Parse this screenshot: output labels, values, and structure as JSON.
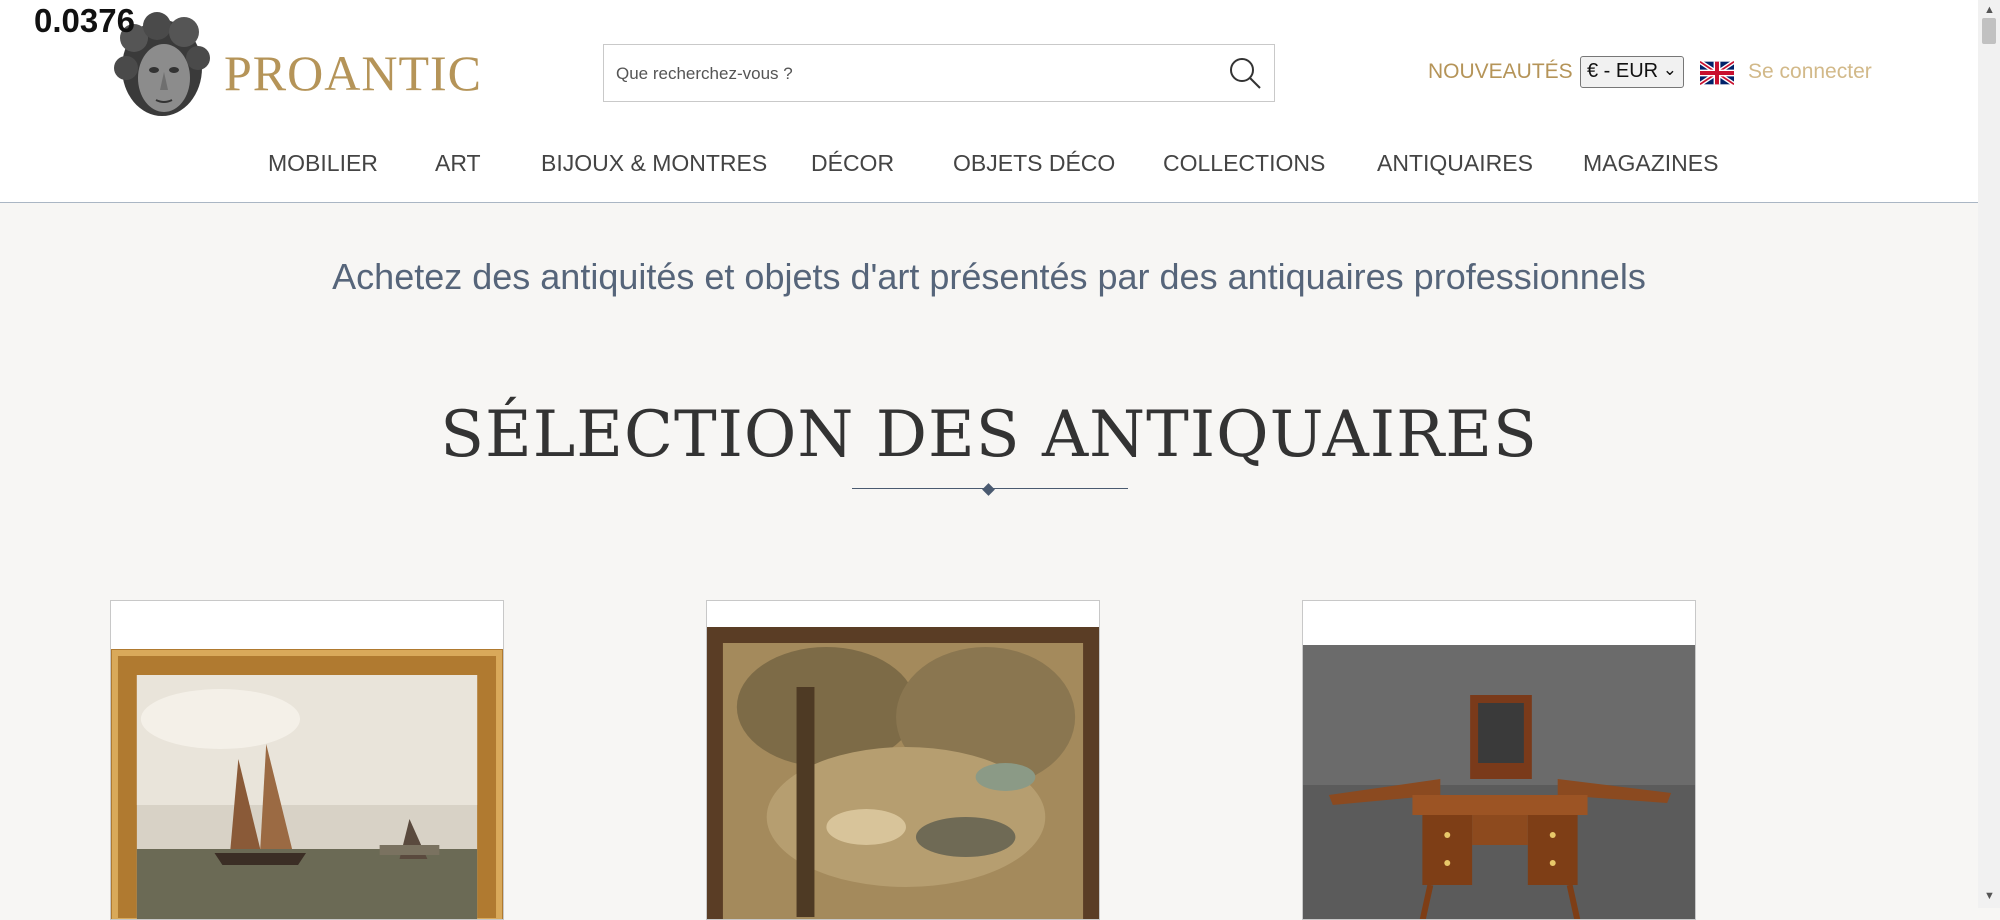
{
  "overlay_number": "0.0376",
  "logo": {
    "text": "PROANTIC",
    "icon": "sculpted-head-logo"
  },
  "search": {
    "placeholder": "Que recherchez-vous ?",
    "value": "",
    "icon": "search-icon"
  },
  "header_links": {
    "nouveautes": "NOUVEAUTÉS",
    "currency": "€ - EUR",
    "flag_icon": "uk-flag-icon",
    "login": "Se connecter"
  },
  "nav": {
    "items": [
      "MOBILIER",
      "ART",
      "BIJOUX & MONTRES",
      "DÉCOR",
      "OBJETS DÉCO",
      "COLLECTIONS",
      "ANTIQUAIRES",
      "MAGAZINES"
    ]
  },
  "main": {
    "tagline": "Achetez des antiquités et objets d'art présentés par des antiquaires professionnels",
    "section_title": "SÉLECTION DES ANTIQUAIRES",
    "cards": [
      {
        "subject": "marine-painting-in-gilt-frame"
      },
      {
        "subject": "antique-tapestry"
      },
      {
        "subject": "louis-xv-dressing-table"
      }
    ]
  },
  "colors": {
    "brand_gold": "#b59458",
    "login_gold": "#d2b989",
    "tagline_blue": "#56657a",
    "background": "#f7f6f4"
  }
}
